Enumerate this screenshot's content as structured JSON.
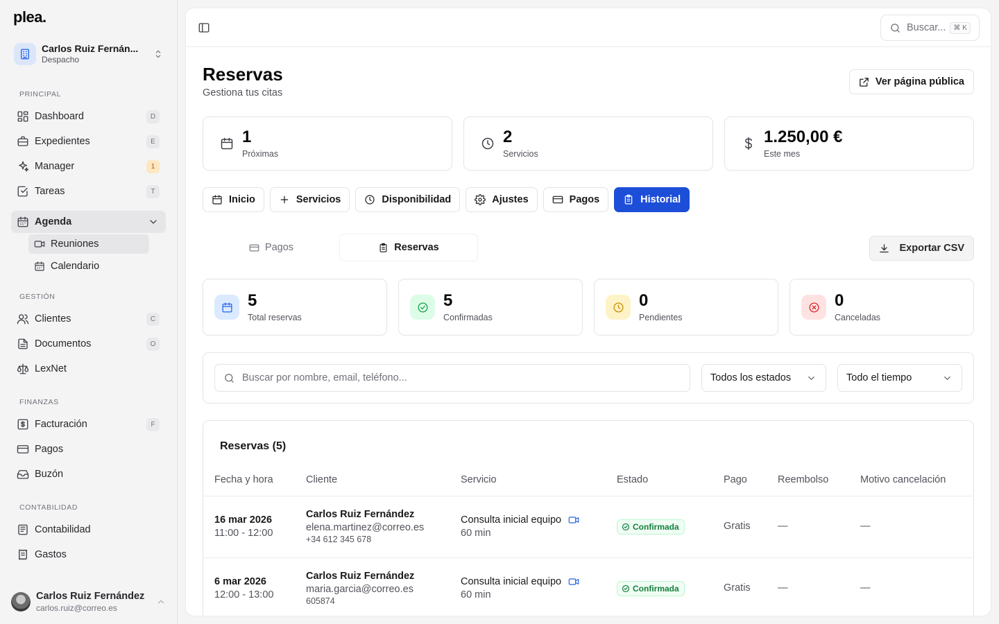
{
  "sidebar": {
    "logo": "plea.",
    "account": {
      "name": "Carlos Ruiz Fernán...",
      "role": "Despacho"
    },
    "sections": {
      "principal": "PRINCIPAL",
      "gestion": "GESTIÓN",
      "finanzas": "FINANZAS",
      "contabilidad": "CONTABILIDAD"
    },
    "items": {
      "dashboard": {
        "label": "Dashboard",
        "key": "D"
      },
      "expedientes": {
        "label": "Expedientes",
        "key": "E"
      },
      "manager": {
        "label": "Manager",
        "key": "1"
      },
      "tareas": {
        "label": "Tareas",
        "key": "T"
      },
      "agenda": {
        "label": "Agenda"
      },
      "reuniones": {
        "label": "Reuniones"
      },
      "calendario": {
        "label": "Calendario"
      },
      "clientes": {
        "label": "Clientes",
        "key": "C"
      },
      "documentos": {
        "label": "Documentos",
        "key": "O"
      },
      "lexnet": {
        "label": "LexNet"
      },
      "facturacion": {
        "label": "Facturación",
        "key": "F"
      },
      "pagos": {
        "label": "Pagos"
      },
      "buzon": {
        "label": "Buzón"
      },
      "contabilidad": {
        "label": "Contabilidad"
      },
      "gastos": {
        "label": "Gastos"
      }
    },
    "user": {
      "name": "Carlos Ruiz Fernández",
      "email": "carlos.ruiz@correo.es"
    }
  },
  "topbar": {
    "search_label": "Buscar...",
    "search_shortcut": "⌘ K"
  },
  "page": {
    "title": "Reservas",
    "subtitle": "Gestiona tus citas",
    "public_button": "Ver página pública"
  },
  "kpis": [
    {
      "value": "1",
      "label": "Próximas",
      "icon": "calendar-icon"
    },
    {
      "value": "2",
      "label": "Servicios",
      "icon": "clock-icon"
    },
    {
      "value": "1.250,00 €",
      "label": "Este mes",
      "icon": "dollar-icon"
    }
  ],
  "tabs": [
    {
      "label": "Inicio",
      "icon": "calendar-icon"
    },
    {
      "label": "Servicios",
      "icon": "plus-icon"
    },
    {
      "label": "Disponibilidad",
      "icon": "clock-icon"
    },
    {
      "label": "Ajustes",
      "icon": "gear-icon"
    },
    {
      "label": "Pagos",
      "icon": "card-icon"
    },
    {
      "label": "Historial",
      "icon": "clipboard-icon",
      "active": true
    }
  ],
  "subtabs": [
    {
      "label": "Pagos",
      "icon": "card-icon"
    },
    {
      "label": "Reservas",
      "icon": "clipboard-icon",
      "active": true
    }
  ],
  "export_button": "Exportar CSV",
  "stats": [
    {
      "value": "5",
      "label": "Total reservas",
      "color": "#2563eb",
      "bg": "#dbeafe"
    },
    {
      "value": "5",
      "label": "Confirmadas",
      "color": "#16a34a",
      "bg": "#dcfce7"
    },
    {
      "value": "0",
      "label": "Pendientes",
      "color": "#ca8a04",
      "bg": "#fef3c7"
    },
    {
      "value": "0",
      "label": "Canceladas",
      "color": "#dc2626",
      "bg": "#fee2e2"
    }
  ],
  "filters": {
    "search_placeholder": "Buscar por nombre, email, teléfono...",
    "status": "Todos los estados",
    "period": "Todo el tiempo"
  },
  "table": {
    "title": "Reservas (5)",
    "columns": [
      "Fecha y hora",
      "Cliente",
      "Servicio",
      "Estado",
      "Pago",
      "Reembolso",
      "Motivo cancelación"
    ],
    "rows": [
      {
        "date": "16 mar 2026",
        "time": "11:00 - 12:00",
        "client": "Carlos Ruiz Fernández",
        "email": "elena.martinez@correo.es",
        "phone": "+34 612 345 678",
        "service": "Consulta inicial equipo",
        "duration": "60 min",
        "status": "Confirmada",
        "payment": "Gratis",
        "refund": "—",
        "reason": "—"
      },
      {
        "date": "6 mar 2026",
        "time": "12:00 - 13:00",
        "client": "Carlos Ruiz Fernández",
        "email": "maria.garcia@correo.es",
        "phone": "605874",
        "service": "Consulta inicial equipo",
        "duration": "60 min",
        "status": "Confirmada",
        "payment": "Gratis",
        "refund": "—",
        "reason": "—"
      }
    ]
  }
}
